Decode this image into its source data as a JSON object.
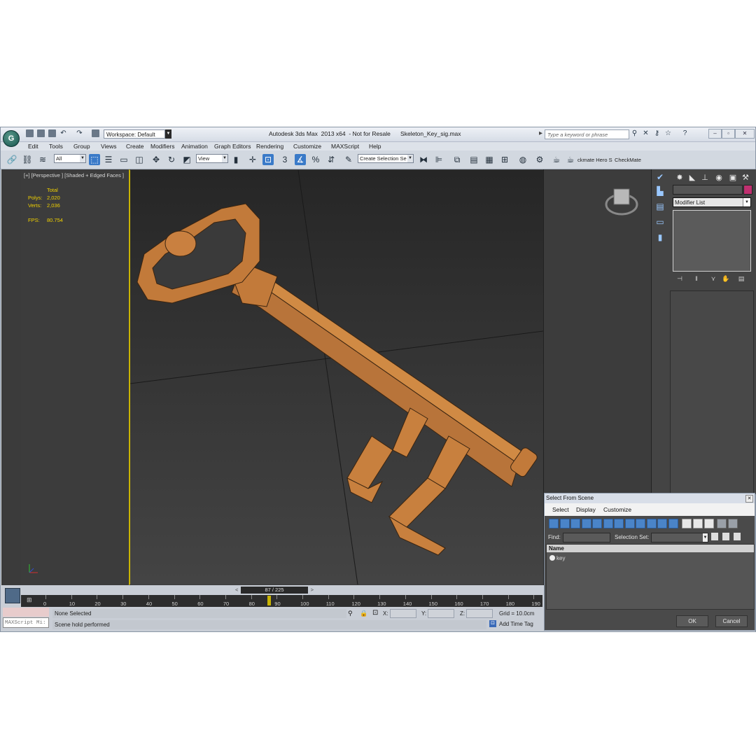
{
  "window": {
    "title": "Autodesk 3ds Max  2013 x64  - Not for Resale      Skeleton_Key_sig.max",
    "workspace": "Workspace: Default",
    "search_placeholder": "Type a keyword or phrase"
  },
  "menu": [
    "Edit",
    "Tools",
    "Group",
    "Views",
    "Create",
    "Modifiers",
    "Animation",
    "Graph Editors",
    "Rendering",
    "Customize",
    "MAXScript",
    "Help"
  ],
  "toolbar": {
    "filter": "All",
    "reference_coord": "View",
    "selection_set": "Create Selection Se",
    "snap_label": "3",
    "plugin_label": "ckmate Hero S",
    "checkmate_label": "CheckMate"
  },
  "viewport": {
    "label": "[+] [Perspective ] [Shaded + Edged Faces ]",
    "stats": {
      "total_label": "Total",
      "polys_label": "Polys:",
      "polys_value": "2,020",
      "verts_label": "Verts:",
      "verts_value": "2,036",
      "fps_label": "FPS:",
      "fps_value": "80.754"
    }
  },
  "command_panel": {
    "modifier_list": "Modifier List"
  },
  "timeline": {
    "slider": "87 / 225",
    "current_frame": 87,
    "ticks": [
      "0",
      "10",
      "20",
      "30",
      "40",
      "50",
      "60",
      "70",
      "80",
      "90",
      "100",
      "110",
      "120",
      "130",
      "140",
      "150",
      "160",
      "170",
      "180",
      "190"
    ]
  },
  "status": {
    "maxscript": "MAXScript Mi:",
    "selection": "None Selected",
    "prompt": "Scene hold performed",
    "x_label": "X:",
    "y_label": "Y:",
    "z_label": "Z:",
    "grid": "Grid = 10.0cm",
    "add_time_tag": "Add Time Tag"
  },
  "select_from_scene": {
    "title": "Select From Scene",
    "menus": [
      "Select",
      "Display",
      "Customize"
    ],
    "find_label": "Find:",
    "selection_set_label": "Selection Set:",
    "column_name": "Name",
    "items": [
      "key"
    ],
    "ok": "OK",
    "cancel": "Cancel"
  }
}
